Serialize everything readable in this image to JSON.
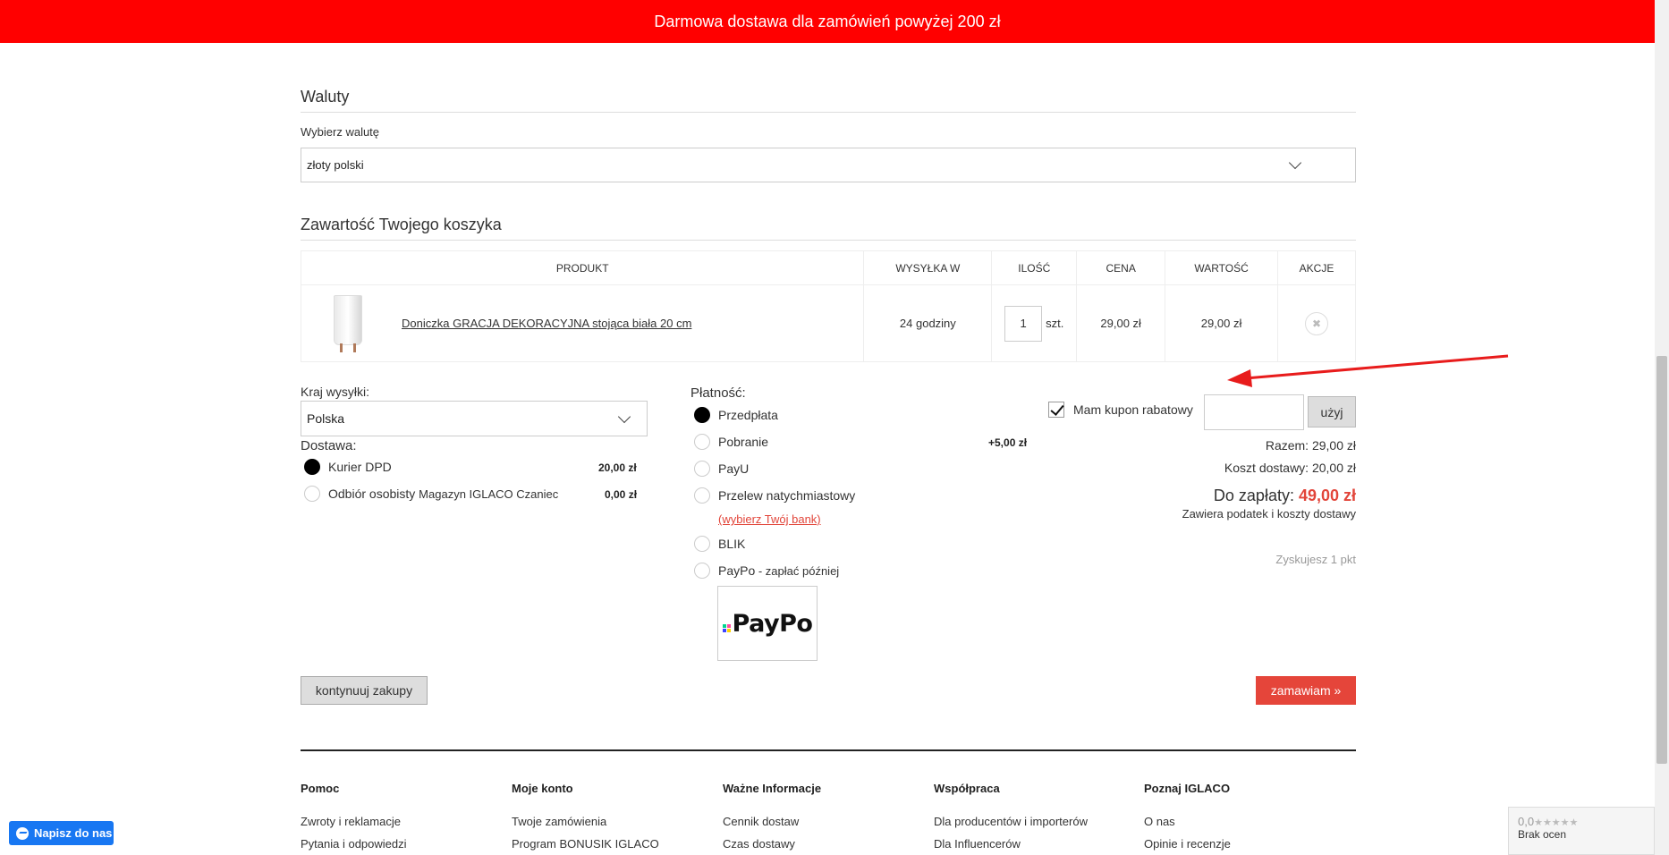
{
  "topbar": {
    "text": "Darmowa dostawa dla zamówień powyżej 200 zł"
  },
  "currency": {
    "title": "Waluty",
    "label": "Wybierz walutę",
    "selected": "złoty polski"
  },
  "cart": {
    "title": "Zawartość Twojego koszyka",
    "headers": [
      "PRODUKT",
      "WYSYŁKA W",
      "ILOŚĆ",
      "CENA",
      "WARTOŚĆ",
      "AKCJE"
    ],
    "item": {
      "name": "Doniczka GRACJA DEKORACYJNA stojąca biała 20 cm",
      "shipping": "24 godziny",
      "qty": "1",
      "unit": "szt.",
      "price": "29,00 zł",
      "value": "29,00 zł",
      "remove_glyph": "✖"
    }
  },
  "shipping": {
    "country_label": "Kraj wysyłki:",
    "country": "Polska",
    "delivery_label": "Dostawa:",
    "options": [
      {
        "label": "Kurier DPD",
        "extra": "",
        "price": "20,00 zł",
        "checked": true
      },
      {
        "label": "Odbiór osobisty",
        "extra": "Magazyn IGLACO Czaniec",
        "price": "0,00 zł",
        "checked": false
      }
    ]
  },
  "payment": {
    "label": "Płatność:",
    "options": [
      {
        "label": "Przedpłata",
        "extra": "",
        "price": "",
        "checked": true
      },
      {
        "label": "Pobranie",
        "extra": "",
        "price": "+5,00 zł",
        "checked": false
      },
      {
        "label": "PayU",
        "extra": "",
        "price": "",
        "checked": false
      },
      {
        "label": "Przelew natychmiastowy",
        "extra": "",
        "price": "",
        "checked": false
      },
      {
        "label": "BLIK",
        "extra": "",
        "price": "",
        "checked": false
      },
      {
        "label": "PayPo",
        "extra": " - zapłać później",
        "price": "",
        "checked": false
      }
    ],
    "bank_link": "(wybierz Twój bank)",
    "paypo_logo": "PayPo"
  },
  "summary": {
    "coupon_label": "Mam kupon rabatowy",
    "coupon_button": "użyj",
    "subtotal": "Razem: 29,00 zł",
    "delivery_cost": "Koszt dostawy: 20,00 zł",
    "total_label": "Do zapłaty: ",
    "total_amount": "49,00 zł",
    "tax_note": "Zawiera podatek i koszty dostawy",
    "points": "Zyskujesz 1 pkt"
  },
  "actions": {
    "continue": "kontynuuj zakupy",
    "order": "zamawiam »"
  },
  "footer": {
    "columns": [
      {
        "title": "Pomoc",
        "links": [
          "Zwroty i reklamacje",
          "Pytania i odpowiedzi"
        ]
      },
      {
        "title": "Moje konto",
        "links": [
          "Twoje zamówienia",
          "Program BONUSIK IGLACO"
        ]
      },
      {
        "title": "Ważne Informacje",
        "links": [
          "Cennik dostaw",
          "Czas dostawy"
        ]
      },
      {
        "title": "Współpraca",
        "links": [
          "Dla producentów i importerów",
          "Dla Influencerów"
        ]
      },
      {
        "title": "Poznaj IGLACO",
        "links": [
          "O nas",
          "Opinie i recenzje"
        ]
      }
    ]
  },
  "chat": {
    "label": "Napisz do nas"
  },
  "rating": {
    "score": "0,0",
    "stars": "★★★★★",
    "text": "Brak ocen"
  },
  "colors": {
    "topbar": "#ff0000",
    "accent": "#e5453a",
    "arrow": "#e81c1c"
  }
}
